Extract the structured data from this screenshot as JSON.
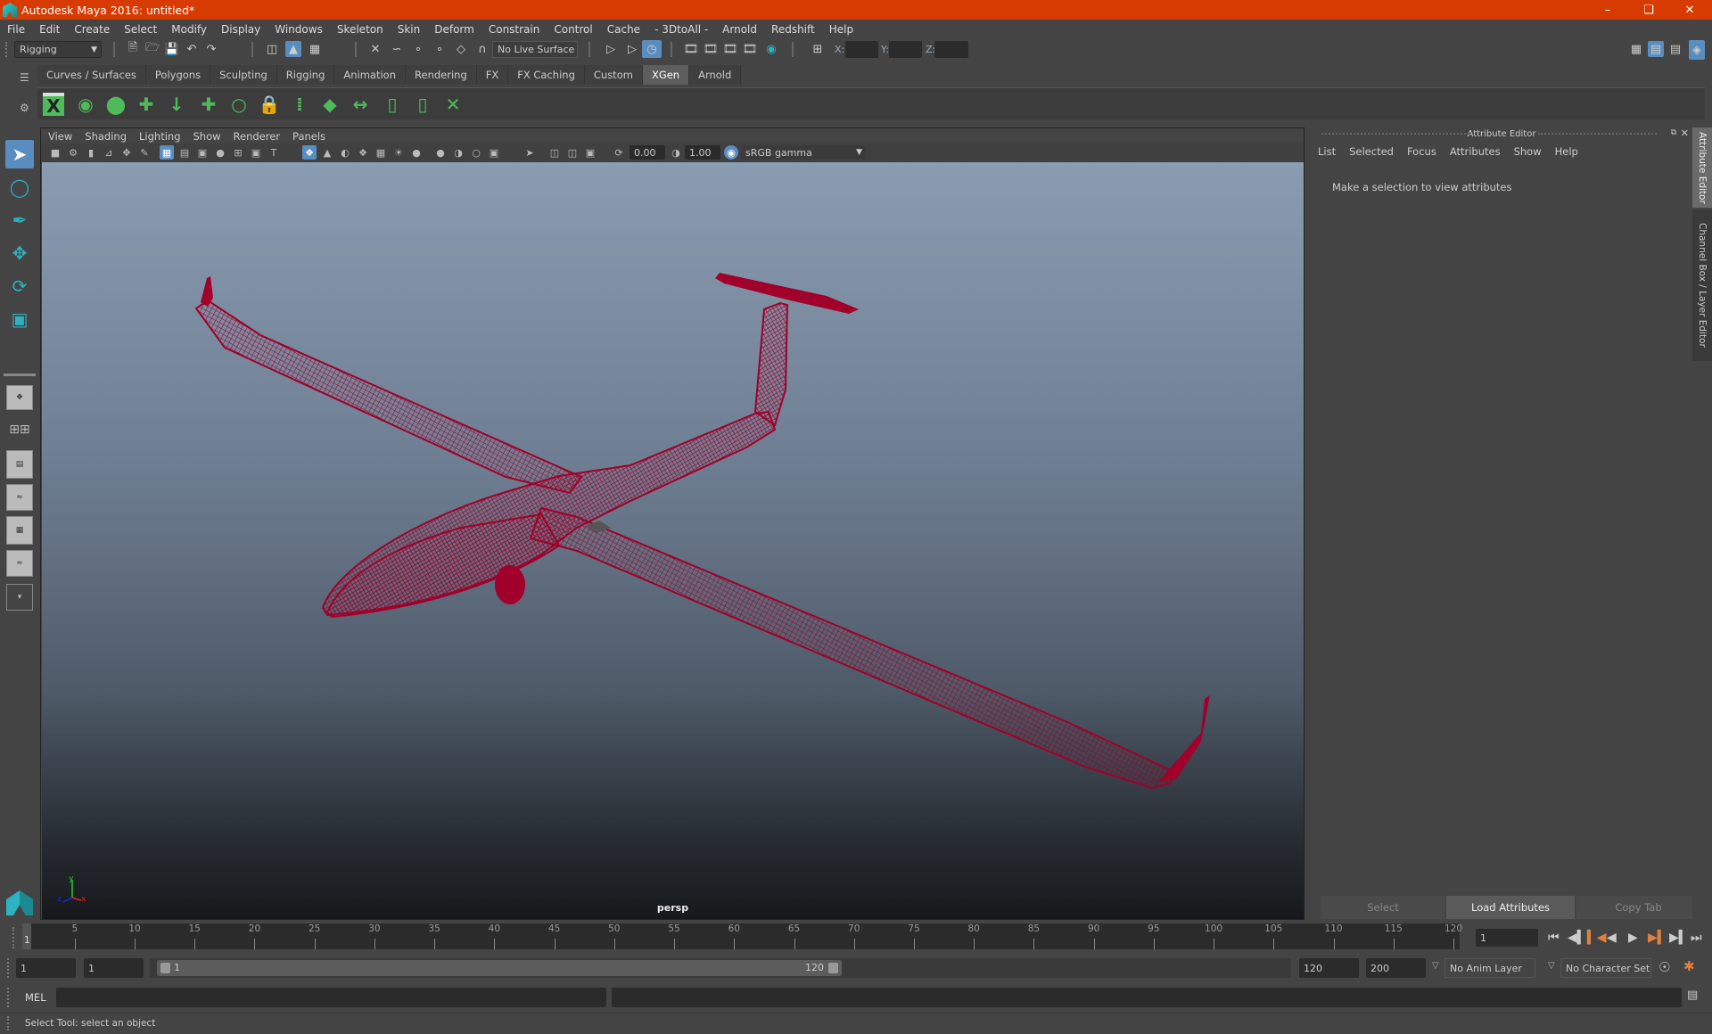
{
  "window": {
    "title": "Autodesk Maya 2016: untitled*",
    "controls": [
      "minimize",
      "restore",
      "close"
    ]
  },
  "menubar": {
    "items": [
      "File",
      "Edit",
      "Create",
      "Select",
      "Modify",
      "Display",
      "Windows",
      "Skeleton",
      "Skin",
      "Deform",
      "Constrain",
      "Control",
      "Cache",
      "- 3DtoAll -",
      "Arnold",
      "Redshift",
      "Help"
    ]
  },
  "toolbar": {
    "mode_menu": "Rigging",
    "live_surface": "No Live Surface",
    "x_label": "X:",
    "y_label": "Y:",
    "z_label": "Z:",
    "x_value": "",
    "y_value": "",
    "z_value": ""
  },
  "shelf": {
    "tabs": [
      "Curves / Surfaces",
      "Polygons",
      "Sculpting",
      "Rigging",
      "Animation",
      "Rendering",
      "FX",
      "FX Caching",
      "Custom",
      "XGen",
      "Arnold"
    ],
    "active_tab": "XGen",
    "icons": [
      "xgen-editor-icon",
      "xgen-preview-icon",
      "xgen-clear-preview-icon",
      "add-guides-icon",
      "sculpt-guides-icon",
      "add-guide-icon",
      "guide-length-icon",
      "lock-guide-icon",
      "bend-guide-icon",
      "guide-to-curves-icon",
      "flip-guides-icon",
      "select-guides-icon",
      "rebuild-guides-icon",
      "delete-guides-icon"
    ]
  },
  "panel": {
    "menu": [
      "View",
      "Shading",
      "Lighting",
      "Show",
      "Renderer",
      "Panels"
    ],
    "exposure": "0.00",
    "gamma": "1.00",
    "color_space": "sRGB gamma",
    "camera_label": "persp"
  },
  "attribute_editor": {
    "header": "Attribute Editor",
    "menu": [
      "List",
      "Selected",
      "Focus",
      "Attributes",
      "Show",
      "Help"
    ],
    "message": "Make a selection to view attributes",
    "buttons": [
      "Select",
      "Load Attributes",
      "Copy Tab"
    ],
    "side_tabs": [
      "Attribute Editor",
      "Channel Box / Layer Editor"
    ]
  },
  "timeline": {
    "ticks": [
      "5",
      "10",
      "15",
      "20",
      "25",
      "30",
      "35",
      "40",
      "45",
      "50",
      "55",
      "60",
      "65",
      "70",
      "75",
      "80",
      "85",
      "90",
      "95",
      "100",
      "105",
      "110",
      "115",
      "120"
    ],
    "current_frame_marker": "1",
    "current_frame": "1"
  },
  "range": {
    "start_time": "1",
    "playback_start": "1",
    "slider_start": "1",
    "slider_end": "120",
    "playback_end": "120",
    "end_time": "200",
    "anim_layer": "No Anim Layer",
    "character_set": "No Character Set"
  },
  "command_line": {
    "language": "MEL",
    "input": "",
    "output": ""
  },
  "status": {
    "help_line": "Select Tool: select an object"
  },
  "colors": {
    "title_bar": "#d83b01",
    "wireframe": "#a0002a",
    "highlight": "#5a8dbf",
    "xgen_green": "#4fba5a"
  }
}
